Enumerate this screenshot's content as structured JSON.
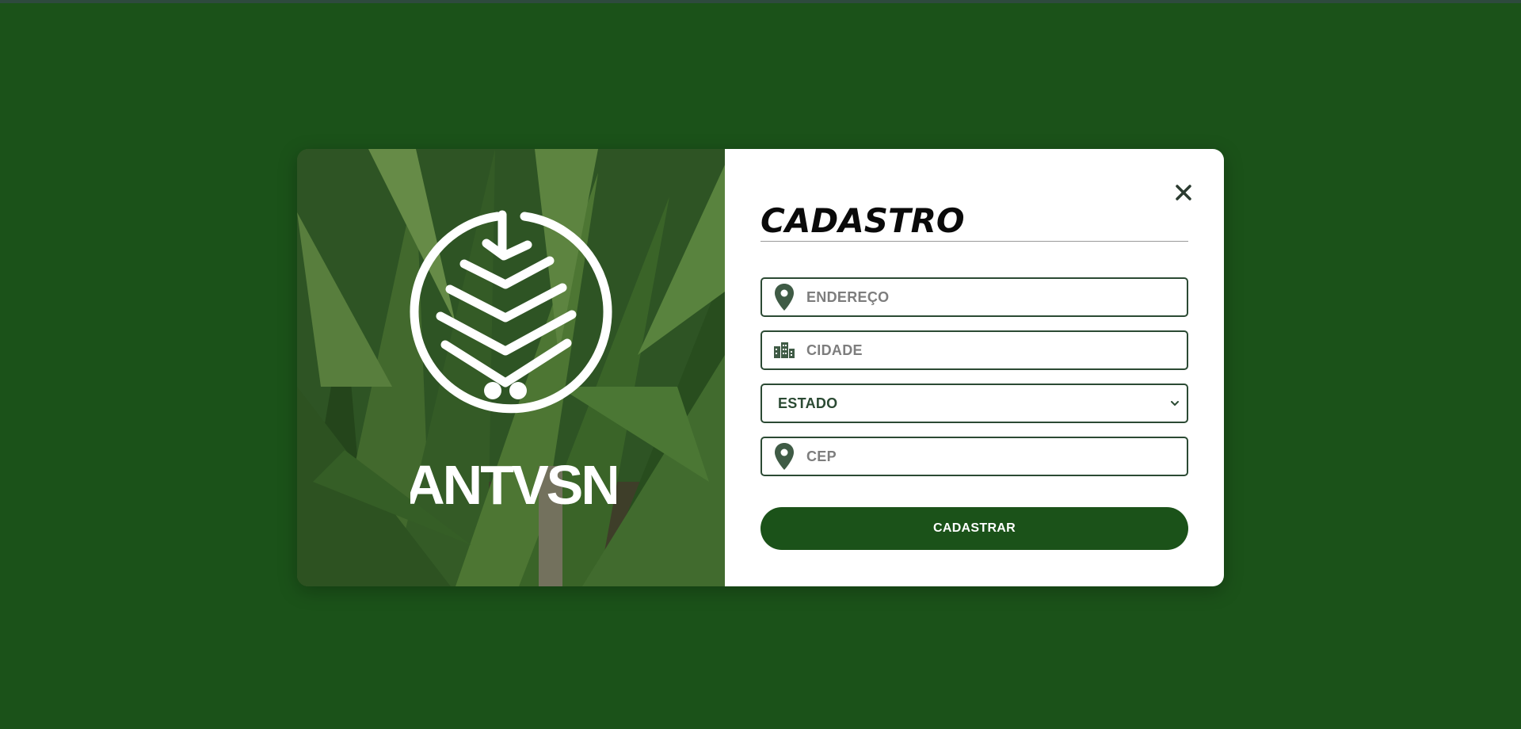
{
  "colors": {
    "background": "#1b5219",
    "accent": "#1b5219",
    "field_border": "#2b4a33",
    "icon": "#3f5b45"
  },
  "brand": {
    "wordmark": "ANTVSN",
    "logo_icon": "palm-leaf-circle-logo"
  },
  "form": {
    "title": "CADASTRO",
    "close_icon": "close-icon",
    "fields": {
      "endereco": {
        "placeholder": "ENDEREÇO",
        "value": "",
        "icon": "map-pin-icon"
      },
      "cidade": {
        "placeholder": "CIDADE",
        "value": "",
        "icon": "city-buildings-icon"
      },
      "estado": {
        "selected": "ESTADO",
        "icon": "chevron-down-icon"
      },
      "cep": {
        "placeholder": "CEP",
        "value": "",
        "icon": "map-pin-icon"
      }
    },
    "submit_label": "CADASTRAR"
  }
}
